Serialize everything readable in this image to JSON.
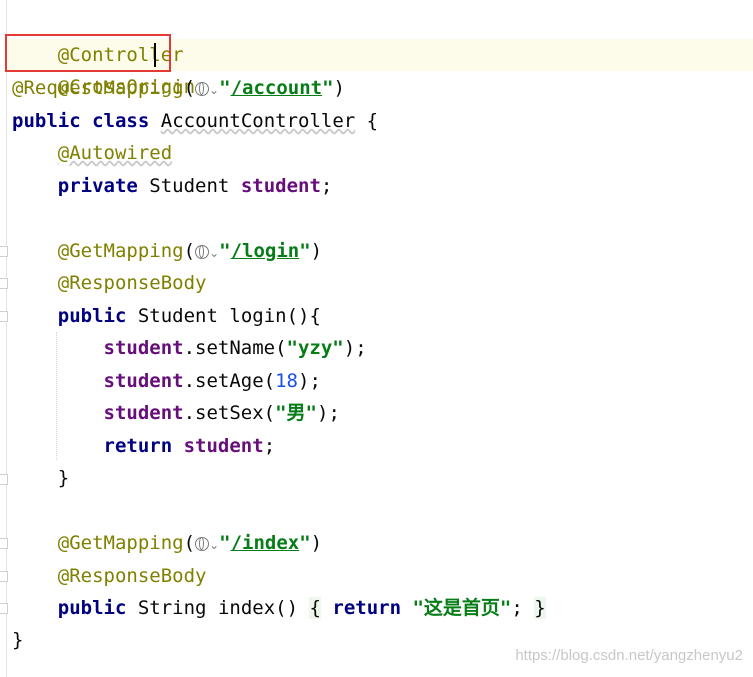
{
  "code": {
    "l1_annotation": "@Controller",
    "l2_annotation": "@CrossOrigin",
    "l3": {
      "annotation": "@RequestMapping",
      "open": "(",
      "quote_open": "\"",
      "url": "/account",
      "quote_close": "\"",
      "close": ")"
    },
    "l4": {
      "kw1": "public",
      "kw2": "class",
      "name": "AccountController",
      "brace": "{"
    },
    "l5_annotation": "@Autowired",
    "l6": {
      "kw": "private",
      "type": "Student",
      "field": "student",
      "semi": ";"
    },
    "l8": {
      "annotation": "@GetMapping",
      "open": "(",
      "quote_open": "\"",
      "url": "/login",
      "quote_close": "\"",
      "close": ")"
    },
    "l9_annotation": "@ResponseBody",
    "l10": {
      "kw": "public",
      "type": "Student",
      "method": "login(){"
    },
    "l11": {
      "field": "student",
      "call": ".setName(",
      "str": "\"yzy\"",
      "end": ");"
    },
    "l12": {
      "field": "student",
      "call": ".setAge(",
      "num": "18",
      "end": ");"
    },
    "l13": {
      "field": "student",
      "call": ".setSex(",
      "str": "\"男\"",
      "end": ");"
    },
    "l14": {
      "kw": "return",
      "field": "student",
      "semi": ";"
    },
    "l15_brace": "}",
    "l17": {
      "annotation": "@GetMapping",
      "open": "(",
      "quote_open": "\"",
      "url": "/index",
      "quote_close": "\"",
      "close": ")"
    },
    "l18_annotation": "@ResponseBody",
    "l19": {
      "kw": "public",
      "type": "String",
      "method": "index()",
      "brace_open": "{",
      "ret": "return",
      "str": "\"这是首页\"",
      "semi": ";",
      "brace_close": "}"
    },
    "l20_brace": "}"
  },
  "watermark": "https://blog.csdn.net/yangzhenyu2",
  "colors": {
    "annotation": "#808000",
    "keyword": "#000080",
    "field": "#660e7a",
    "string": "#067d17",
    "number": "#1750eb",
    "highlight_box": "#e53935"
  },
  "icons": [
    "globe-icon",
    "chevron-down-icon"
  ]
}
